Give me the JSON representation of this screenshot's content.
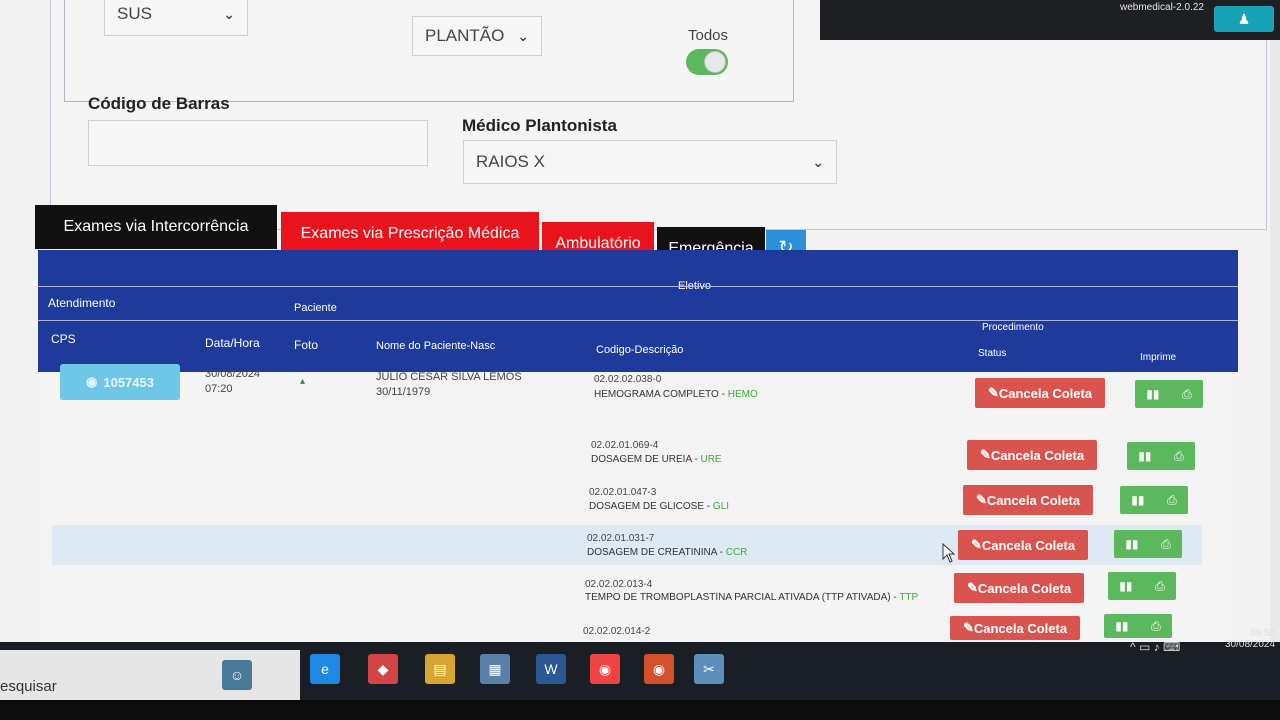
{
  "header": {
    "version": "webmedical-2.0.22"
  },
  "filters": {
    "convenio": "SUS",
    "setor": "PLANTÃO",
    "todos_label": "Todos",
    "codigo_barras_label": "Código de Barras",
    "codigo_barras_value": "",
    "medico_label": "Médico Plantonista",
    "medico_value": "RAIOS X"
  },
  "tabs": [
    {
      "label": "Exames via Intercorrência"
    },
    {
      "label": "Exames via Prescrição Médica"
    },
    {
      "label": "Ambulatório"
    },
    {
      "label": "Emergência"
    }
  ],
  "table": {
    "group_headers": {
      "eletivo": "Eletivo",
      "atendimento": "Atendimento",
      "paciente": "Paciente",
      "procedimento": "Procedimento"
    },
    "columns": {
      "cps": "CPS",
      "data_hora": "Data/Hora",
      "foto": "Foto",
      "nome": "Nome do Paciente-Nasc",
      "codigo": "Codigo-Descrição",
      "status": "Status",
      "imprime": "Imprime"
    },
    "patient": {
      "cps": "1057453",
      "data": "30/08/2024",
      "hora": "07:20",
      "nome": "JULIO CESAR SILVA LEMOS",
      "nascimento": "30/11/1979"
    },
    "exams": [
      {
        "code": "02.02.02.038-0",
        "desc": "HEMOGRAMA COMPLETO - ",
        "abbr": "HEMO",
        "action": "Cancela Coleta"
      },
      {
        "code": "02.02.01.069-4",
        "desc": "DOSAGEM DE UREIA - ",
        "abbr": "URE",
        "action": "Cancela Coleta"
      },
      {
        "code": "02.02.01.047-3",
        "desc": "DOSAGEM DE GLICOSE - ",
        "abbr": "GLI",
        "action": "Cancela Coleta"
      },
      {
        "code": "02.02.01.031-7",
        "desc": "DOSAGEM DE CREATININA - ",
        "abbr": "CCR",
        "action": "Cancela Coleta"
      },
      {
        "code": "02.02.02.013-4",
        "desc": "TEMPO DE TROMBOPLASTINA PARCIAL ATIVADA (TTP ATIVADA) - ",
        "abbr": "TTP",
        "action": "Cancela Coleta"
      },
      {
        "code": "02.02.02.014-2",
        "desc": "",
        "abbr": "",
        "action": "Cancela Coleta"
      }
    ]
  },
  "taskbar": {
    "search": "esquisar",
    "time": "09:50",
    "date": "30/08/2024"
  }
}
